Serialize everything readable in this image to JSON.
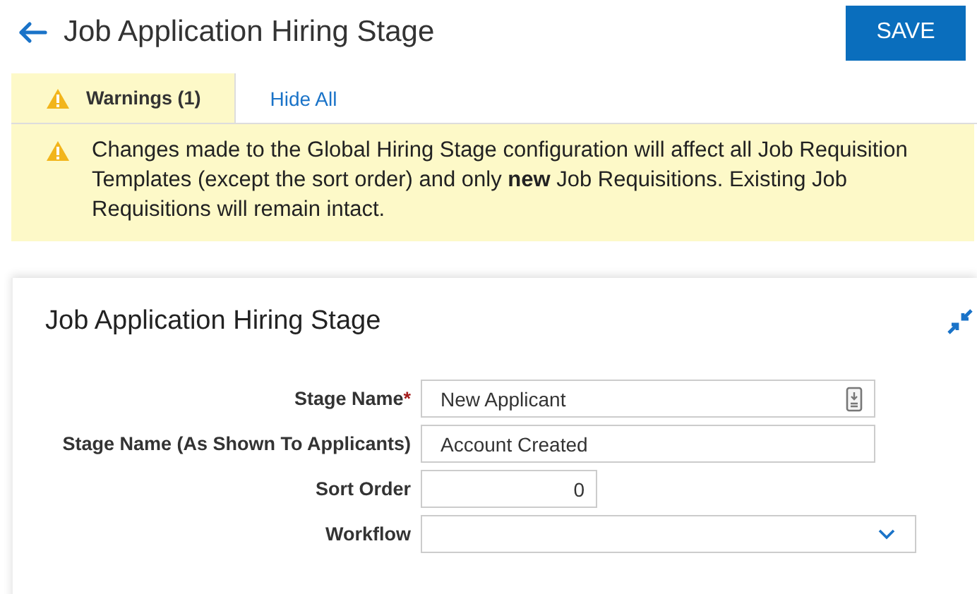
{
  "header": {
    "title": "Job Application Hiring Stage",
    "save_button": "SAVE"
  },
  "tabs": [
    {
      "label": "Warnings (1)",
      "kind": "warning",
      "selected": true
    },
    {
      "label": "Hide All",
      "kind": "link",
      "selected": false
    }
  ],
  "warning": {
    "message": "Changes made to the Global Hiring Stage configuration will affect all Job Requisition Templates (except the sort order) and only **new** Job Requisitions. Existing Job Requisitions will remain intact."
  },
  "card": {
    "title": "Job Application Hiring Stage",
    "fields": [
      {
        "label": "Stage Name",
        "required_mark": "*",
        "kind": "text-icon",
        "value": "New Applicant"
      },
      {
        "label": "Stage Name (As Shown To Applicants)",
        "kind": "text",
        "value": "Account Created"
      },
      {
        "label": "Sort Order",
        "kind": "number",
        "value": "0"
      },
      {
        "label": "Workflow",
        "kind": "select"
      }
    ]
  }
}
